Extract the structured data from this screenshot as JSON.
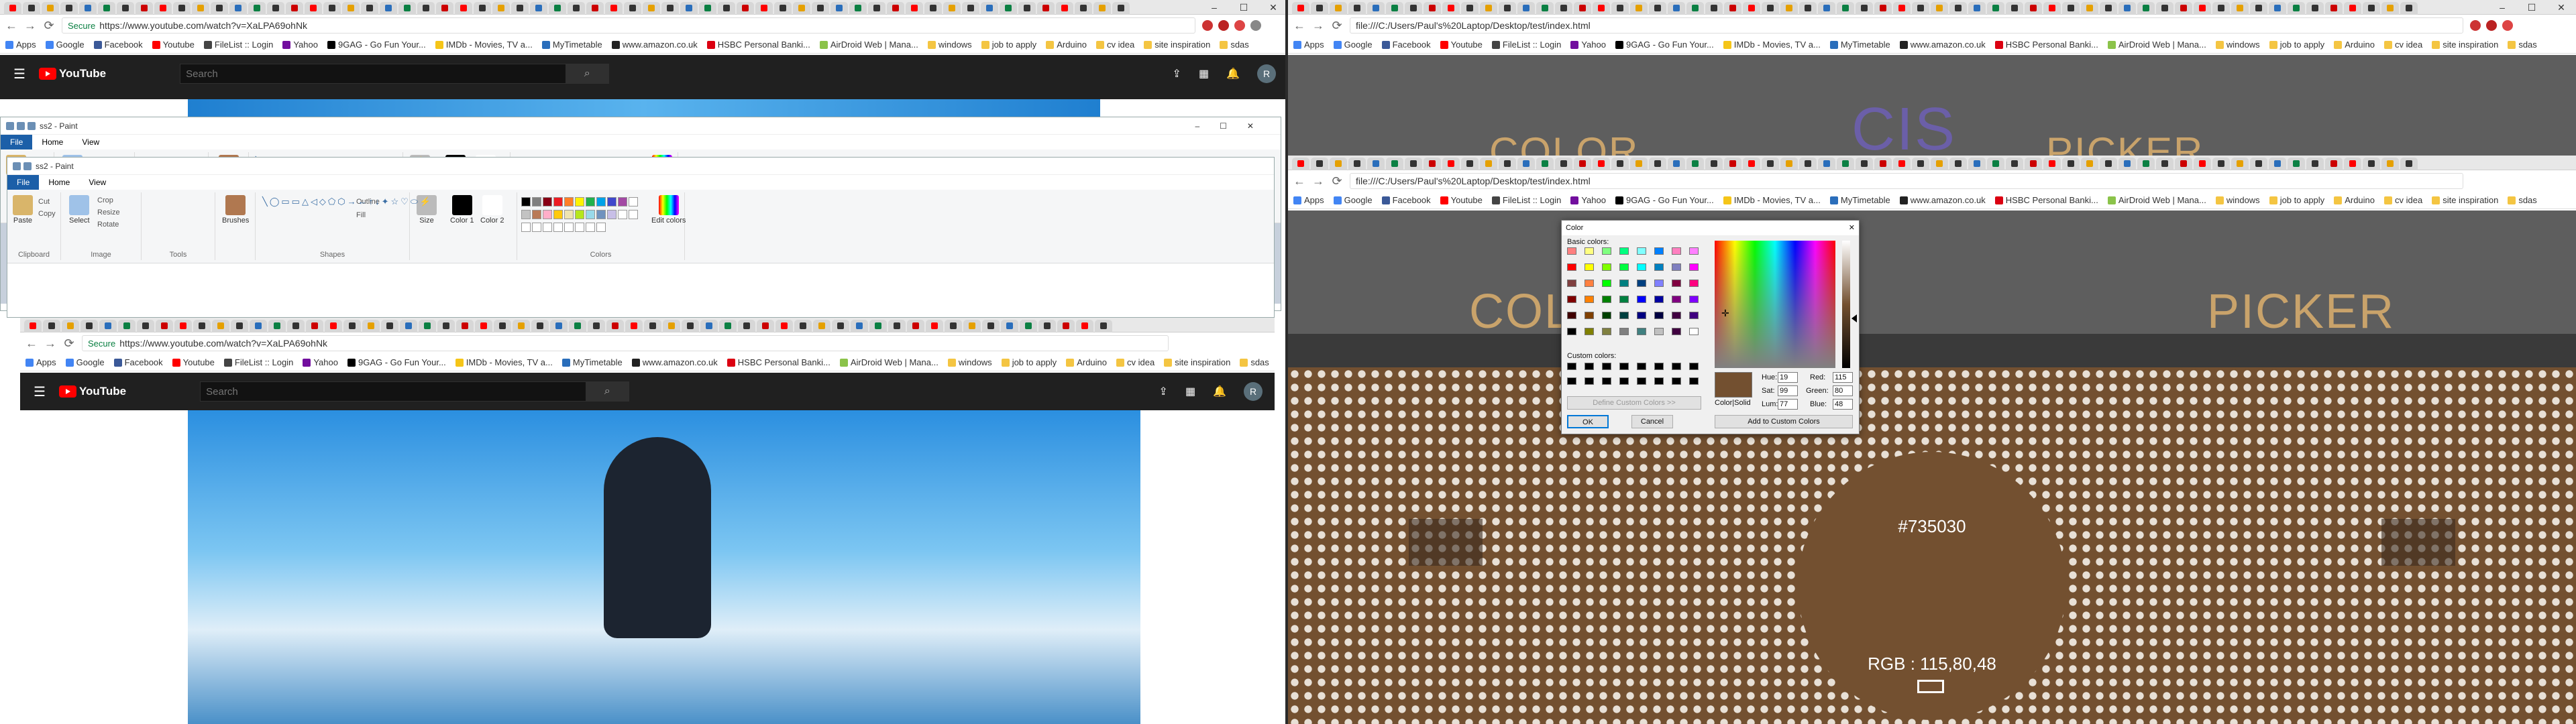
{
  "left_browser": {
    "url": "https://www.youtube.com/watch?v=XaLPA69ohNk",
    "secure_label": "Secure",
    "youtube": {
      "logo": "YouTube",
      "search_placeholder": "Search",
      "avatar": "R"
    }
  },
  "right_browser": {
    "url": "file:///C:/Users/Paul's%20Laptop/Desktop/test/index.html"
  },
  "nested_browser": {
    "url": "https://www.youtube.com/watch?v=XaLPA69ohNk",
    "secure_label": "Secure"
  },
  "bookmarks": [
    "Apps",
    "Google",
    "Facebook",
    "Youtube",
    "FileList :: Login",
    "Yahoo",
    "9GAG - Go Fun Your...",
    "IMDb - Movies, TV a...",
    "MyTimetable",
    "www.amazon.co.uk",
    "HSBC Personal Banki...",
    "AirDroid Web | Mana...",
    "windows",
    "job to apply",
    "Arduino",
    "cv idea",
    "site inspiration",
    "sdas"
  ],
  "bookmark_colors": [
    "#4285f4",
    "#4285f4",
    "#3b5998",
    "#ff0000",
    "#444",
    "#720e9e",
    "#000",
    "#f5c518",
    "#2a6ebb",
    "#222",
    "#db0011",
    "#8bc34a",
    "#f4c542",
    "#f4c542",
    "#f4c542",
    "#f4c542",
    "#f4c542",
    "#f4c542"
  ],
  "bookmark_colors_comment": "",
  "paint": {
    "title": "ss2 - Paint",
    "menu": [
      "File",
      "Home",
      "View"
    ],
    "clipboard": {
      "paste": "Paste",
      "cut": "Cut",
      "copy": "Copy",
      "label": "Clipboard"
    },
    "image": {
      "select": "Select",
      "crop": "Crop",
      "resize": "Resize",
      "rotate": "Rotate",
      "label": "Image"
    },
    "tools_label": "Tools",
    "brushes": "Brushes",
    "shapes": {
      "outline": "Outline",
      "fill": "Fill",
      "label": "Shapes"
    },
    "size": "Size",
    "color1": "Color 1",
    "color2": "Color 2",
    "colors_label": "Colors",
    "edit_colors": "Edit colors",
    "palette": [
      "#000000",
      "#7f7f7f",
      "#880015",
      "#ed1c24",
      "#ff7f27",
      "#fff200",
      "#22b14c",
      "#00a2e8",
      "#3f48cc",
      "#a349a4",
      "#ffffff",
      "#c3c3c3",
      "#b97a57",
      "#ffaec9",
      "#ffc90e",
      "#efe4b0",
      "#b5e61d",
      "#99d9ea",
      "#7092be",
      "#c8bfe7"
    ]
  },
  "colorpage": {
    "heading_left": "COLOR",
    "heading_right": "PICKER",
    "heading_top_mid": "CIS",
    "hex": "#735030",
    "rgb": "RGB : 115,80,48"
  },
  "color_dialog": {
    "title": "Color",
    "basic_label": "Basic colors:",
    "custom_label": "Custom colors:",
    "define_btn": "Define Custom Colors >>",
    "ok": "OK",
    "cancel": "Cancel",
    "color_solid": "Color|Solid",
    "hue_label": "Hue:",
    "hue": "19",
    "sat_label": "Sat:",
    "sat": "99",
    "lum_label": "Lum:",
    "lum": "77",
    "red_label": "Red:",
    "red": "115",
    "green_label": "Green:",
    "green": "80",
    "blue_label": "Blue:",
    "blue": "48",
    "add_custom": "Add to Custom Colors",
    "basic_colors": [
      "#ff8080",
      "#ffff80",
      "#80ff80",
      "#00ff80",
      "#80ffff",
      "#0080ff",
      "#ff80c0",
      "#ff80ff",
      "#ff0000",
      "#ffff00",
      "#80ff00",
      "#00ff40",
      "#00ffff",
      "#0080c0",
      "#8080c0",
      "#ff00ff",
      "#804040",
      "#ff8040",
      "#00ff00",
      "#008080",
      "#004080",
      "#8080ff",
      "#800040",
      "#ff0080",
      "#800000",
      "#ff8000",
      "#008000",
      "#008040",
      "#0000ff",
      "#0000a0",
      "#800080",
      "#8000ff",
      "#400000",
      "#804000",
      "#004000",
      "#004040",
      "#000080",
      "#000040",
      "#400040",
      "#400080",
      "#000000",
      "#808000",
      "#808040",
      "#808080",
      "#408080",
      "#c0c0c0",
      "#400040",
      "#ffffff"
    ]
  }
}
